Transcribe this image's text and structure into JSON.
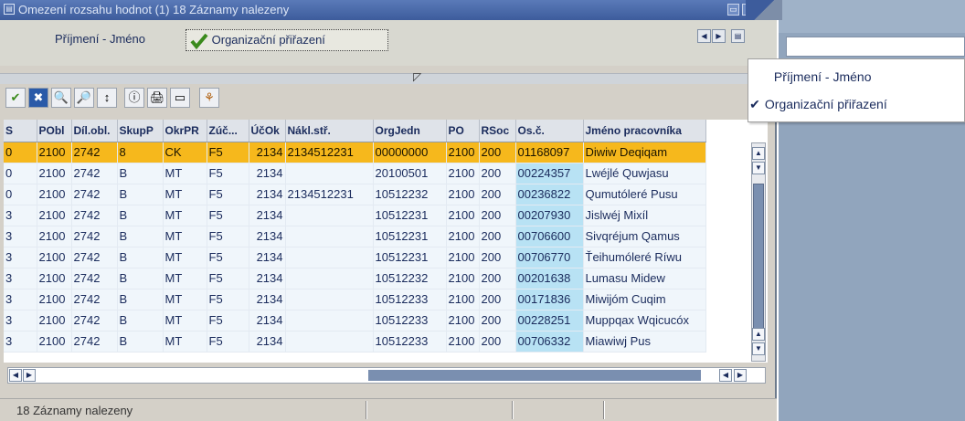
{
  "window": {
    "title": "Omezení rozsahu hodnot (1)  18 Záznamy nalezeny",
    "title_icon": "window-icon",
    "minimize_glyph": "▭",
    "close_glyph": "×"
  },
  "tabs": [
    {
      "label": "Příjmení - Jméno",
      "active": false
    },
    {
      "label": "Organizační přiřazení",
      "active": true
    }
  ],
  "tab_nav": {
    "prev": "◀",
    "next": "▶",
    "menu": "▤"
  },
  "tab_menu": {
    "items": [
      {
        "label": "Příjmení - Jméno",
        "checked": false
      },
      {
        "label": "Organizační přiřazení",
        "checked": true
      }
    ],
    "check_glyph": "✔"
  },
  "toolbar": {
    "icons": [
      "check-icon",
      "cancel-icon",
      "find-icon",
      "find-next-icon",
      "sort-icon",
      "info-icon",
      "print-icon",
      "details-icon",
      "tree-icon"
    ],
    "glyphs": [
      "✔",
      "✖",
      "🔍",
      "🔎",
      "↕",
      "ⓘ",
      "🖨",
      "▭",
      "⚘"
    ]
  },
  "table": {
    "columns": [
      "S",
      "PObl",
      "Díl.obl.",
      "SkupP",
      "OkrPR",
      "Zúč...",
      "ÚčOk",
      "Nákl.stř.",
      "OrgJedn",
      "PO",
      "RSoc",
      "Os.č.",
      "Jméno pracovníka"
    ],
    "rows": [
      [
        "0",
        "2100",
        "2742",
        "8",
        "CK",
        "F5",
        "2134",
        "2134512231",
        "00000000",
        "2100",
        "200",
        "01168097",
        "Diwiw Deqiqam"
      ],
      [
        "0",
        "2100",
        "2742",
        "B",
        "MT",
        "F5",
        "2134",
        "",
        "20100501",
        "2100",
        "200",
        "00224357",
        "Lwéjlé Quwjasu"
      ],
      [
        "0",
        "2100",
        "2742",
        "B",
        "MT",
        "F5",
        "2134",
        "2134512231",
        "10512232",
        "2100",
        "200",
        "00236822",
        "Qumutóleré Pusu"
      ],
      [
        "3",
        "2100",
        "2742",
        "B",
        "MT",
        "F5",
        "2134",
        "",
        "10512231",
        "2100",
        "200",
        "00207930",
        "Jislwéj Mixíl"
      ],
      [
        "3",
        "2100",
        "2742",
        "B",
        "MT",
        "F5",
        "2134",
        "",
        "10512231",
        "2100",
        "200",
        "00706600",
        "Sivqréjum Qamus"
      ],
      [
        "3",
        "2100",
        "2742",
        "B",
        "MT",
        "F5",
        "2134",
        "",
        "10512231",
        "2100",
        "200",
        "00706770",
        "Ťeihumóleré Ríwu"
      ],
      [
        "3",
        "2100",
        "2742",
        "B",
        "MT",
        "F5",
        "2134",
        "",
        "10512232",
        "2100",
        "200",
        "00201638",
        "Lumasu Midew"
      ],
      [
        "3",
        "2100",
        "2742",
        "B",
        "MT",
        "F5",
        "2134",
        "",
        "10512233",
        "2100",
        "200",
        "00171836",
        "Miwijóm Cuqim"
      ],
      [
        "3",
        "2100",
        "2742",
        "B",
        "MT",
        "F5",
        "2134",
        "",
        "10512233",
        "2100",
        "200",
        "00228251",
        "Muppqax Wqicucóx"
      ],
      [
        "3",
        "2100",
        "2742",
        "B",
        "MT",
        "F5",
        "2134",
        "",
        "10512233",
        "2100",
        "200",
        "00706332",
        "Miawiwj Pus"
      ]
    ],
    "selected_row": 0
  },
  "scroll": {
    "up": "▲",
    "down": "▼",
    "left": "◀",
    "right": "▶"
  },
  "status": {
    "text": "18 Záznamy nalezeny"
  },
  "colors": {
    "selected_row": "#f6b81c",
    "os_column": "#b8e2f4",
    "title_bar": "#3d5c9c"
  }
}
